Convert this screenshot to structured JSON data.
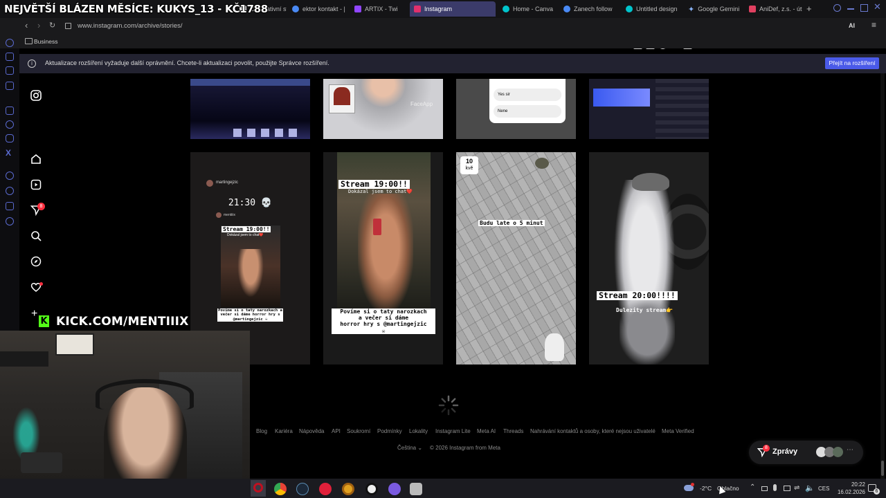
{
  "overlay": {
    "banner": "NEJVĚTŠÍ BLÁZEN MĚSÍCE: KUKYS_13 - KČ1788",
    "kick": "KICK.COM/MENTIIIX"
  },
  "tabs": [
    {
      "label": "Charitativní stre",
      "color": "#e0e0e0"
    },
    {
      "label": "ektor kontakt - |",
      "color": "#4a8af4"
    },
    {
      "label": "ARTIX - Twi",
      "color": "#9146ff"
    },
    {
      "label": "Instagram",
      "color": "#e1306c"
    },
    {
      "label": "Home - Canva",
      "color": "#00c4cc"
    },
    {
      "label": "Zanech follow",
      "color": "#4a8af4"
    },
    {
      "label": "Untitled design",
      "color": "#00c4cc"
    },
    {
      "label": "Google Gemini",
      "color": "#8ab4f8"
    },
    {
      "label": "AniDef, z.s. - út",
      "color": "#e04060"
    }
  ],
  "tab_add": "+",
  "address": {
    "url": "www.instagram.com/archive/stories/"
  },
  "bookmarks": {
    "folder": "Business"
  },
  "toolbar": {
    "ai_label": "AI"
  },
  "notification": {
    "text": "Aktualizace rozšíření vyžaduje další oprávnění. Chcete-li aktualizaci povolit, použijte Správce rozšíření.",
    "button": "Přejít na rozšíření"
  },
  "ig_nav": {
    "notification_badge": "8"
  },
  "stories": {
    "top_row": {
      "s2_watermark": "FaceApp",
      "s3_opt1": "Yes sir",
      "s3_opt2": "Nene"
    },
    "s1": {
      "username": "martingejzic",
      "time": "21:30 💀",
      "sub_user": "mentiiix",
      "stream": "Stream 19:00!!",
      "sub": "Dokázal jsem to chat❤️",
      "bottom": "Povíme si o taty narozkach a večer       si dáme horror hry s @martingejzic ☠"
    },
    "s2": {
      "stream": "Stream 19:00!!",
      "sub": "Dokázal jsem to chat❤️",
      "bottom": "Povíme si o taty narozkach\na večer        si dáme\nhorror hry s @martingejzic\n☠"
    },
    "s3": {
      "day": "10",
      "month": "kvě",
      "caption": "Budu late o 5 minut"
    },
    "s4": {
      "stream": "Stream 20:00!!!!",
      "sub": "Dulezity stream👉"
    }
  },
  "footer": {
    "links": [
      "Blog",
      "Kariéra",
      "Nápověda",
      "API",
      "Soukromí",
      "Podmínky",
      "Lokality",
      "Instagram Lite",
      "Meta AI",
      "Threads",
      "Nahrávání kontaktů a osoby, které nejsou uživatelé",
      "Meta Verified"
    ],
    "language": "Čeština",
    "copyright": "© 2026 Instagram from Meta"
  },
  "messages": {
    "label": "Zprávy",
    "badge": "8"
  },
  "taskbar": {
    "weather_temp": "-2°C",
    "weather_text": "Oblačno",
    "lang": "CES",
    "time": "20:22",
    "date": "16.02.2026",
    "notif_count": "6"
  }
}
